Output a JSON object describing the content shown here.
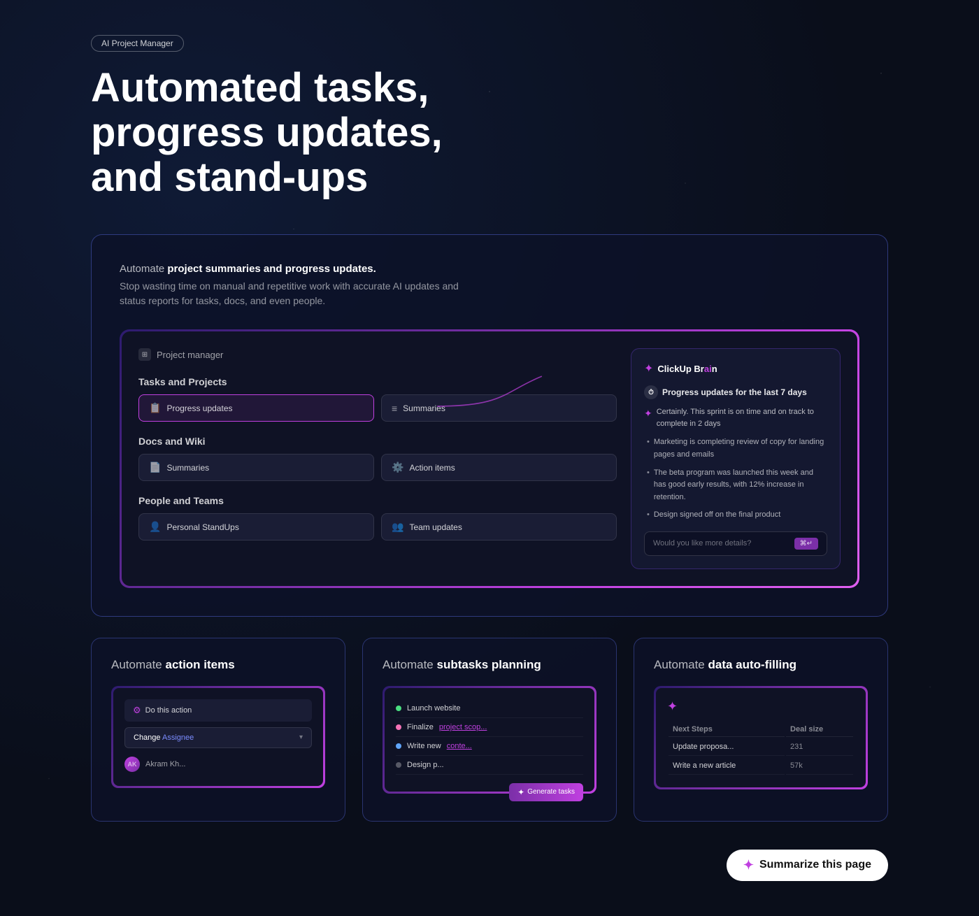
{
  "badge": {
    "label": "AI Project Manager"
  },
  "hero": {
    "title": "Automated tasks, progress updates, and stand-ups"
  },
  "main_card": {
    "subtitle_plain": "Automate ",
    "subtitle_bold": "project summaries and progress updates.",
    "description": "Stop wasting time on manual and repetitive work with accurate AI updates and status reports for tasks, docs, and even people."
  },
  "ui_mockup": {
    "header_label": "Project manager",
    "tasks_section": "Tasks and Projects",
    "docs_section": "Docs and Wiki",
    "people_section": "People and Teams",
    "items": {
      "progress_updates": "Progress updates",
      "summaries_tasks": "Summaries",
      "summaries_docs": "Summaries",
      "action_items": "Action items",
      "personal_standups": "Personal StandUps",
      "team_updates": "Team updates"
    }
  },
  "brain_panel": {
    "logo": "ClickUp Br",
    "logo_o": "ai",
    "logo_n": "n",
    "question": "Progress updates for the last 7 days",
    "answer": "Certainly. This sprint is on time and on track to complete in 2 days",
    "bullets": [
      "Marketing is completing review of copy for landing pages and emails",
      "The beta program was launched this week and has good early results, with 12% increase in retention.",
      "Design signed off on the final product"
    ],
    "input_placeholder": "Would you like more details?",
    "input_btn": "⌘↵"
  },
  "bottom_cards": [
    {
      "title_plain": "Automate ",
      "title_bold": "action items",
      "action_label": "Do this action",
      "change_label": "Change",
      "assignee_label": "Assignee",
      "user_label": "Akram Kh..."
    },
    {
      "title_plain": "Automate ",
      "title_bold": "subtasks planning",
      "items": [
        {
          "dot": "green",
          "text": "Launch website"
        },
        {
          "dot": "pink",
          "text_plain": "Finalize ",
          "text_link": "project scop..."
        },
        {
          "dot": "blue",
          "text_plain": "Write new ",
          "text_link": "conte..."
        },
        {
          "dot": "gray",
          "text_plain": "Design p..."
        }
      ],
      "generate_btn": "Generate tasks"
    },
    {
      "title_plain": "Automate ",
      "title_bold": "data auto-filling",
      "table_headers": [
        "Next Steps",
        "Deal size"
      ],
      "table_rows": [
        {
          "col1_plain": "Update ",
          "col1_link": "proposa...",
          "col2": "231"
        },
        {
          "col1_plain": "Write a ",
          "col1_link": "new article",
          "col2": "57k"
        }
      ]
    }
  ],
  "summarize_btn": {
    "label": "Summarize this page"
  }
}
